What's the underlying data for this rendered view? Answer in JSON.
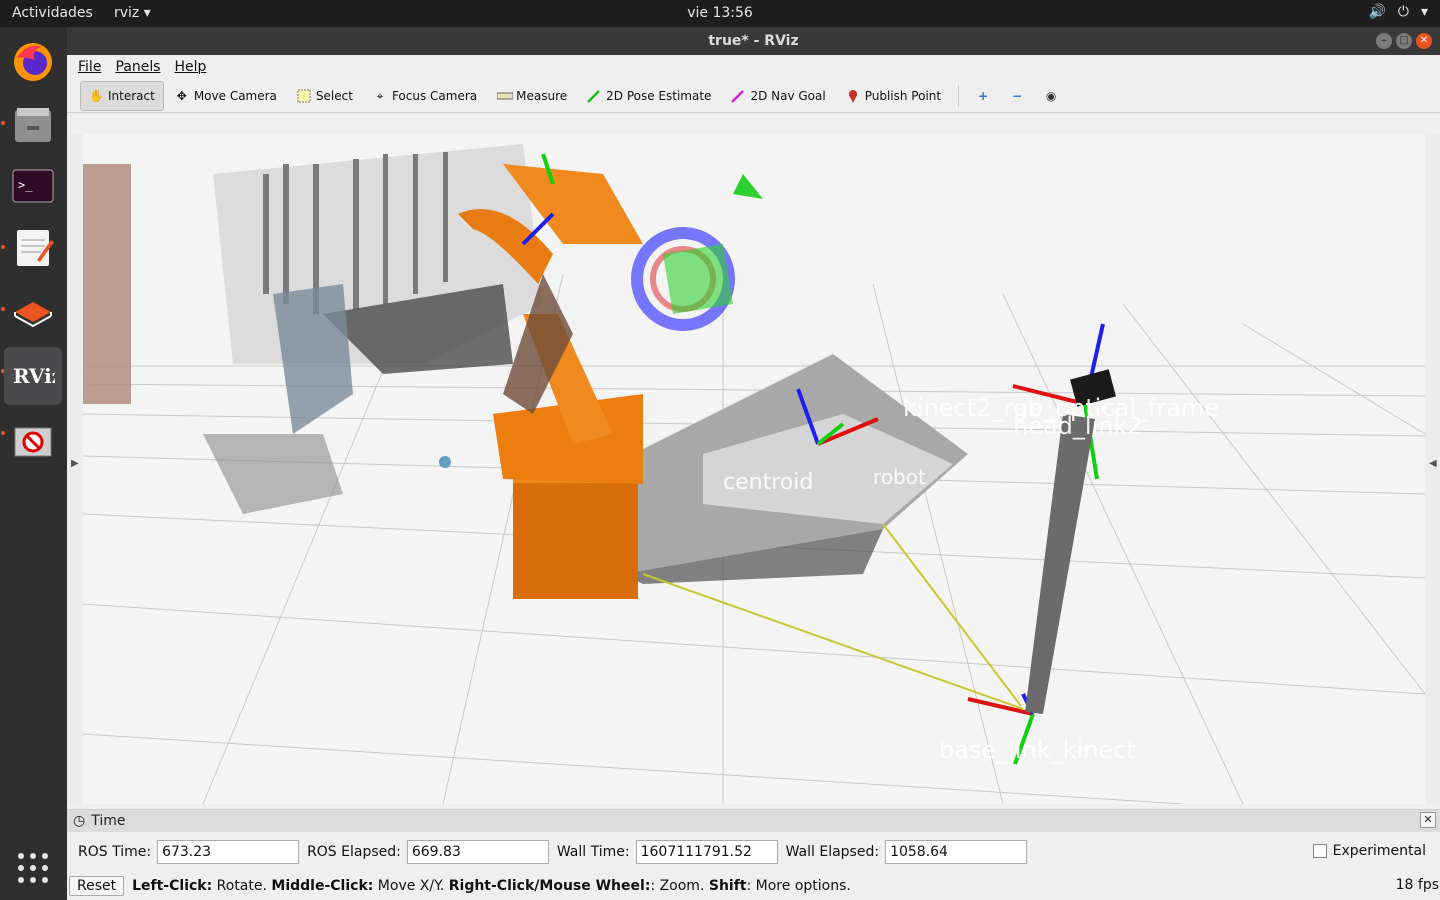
{
  "topbar": {
    "activities": "Actividades",
    "app": "rviz ▾",
    "clock": "vie 13:56"
  },
  "window": {
    "title": "true* - RViz"
  },
  "menu": [
    "File",
    "Panels",
    "Help"
  ],
  "tools": [
    {
      "label": "Interact",
      "icon": "hand-icon"
    },
    {
      "label": "Move Camera",
      "icon": "move-icon"
    },
    {
      "label": "Select",
      "icon": "select-icon"
    },
    {
      "label": "Focus Camera",
      "icon": "focus-icon"
    },
    {
      "label": "Measure",
      "icon": "ruler-icon"
    },
    {
      "label": "2D Pose Estimate",
      "icon": "green-arrow-icon"
    },
    {
      "label": "2D Nav Goal",
      "icon": "magenta-arrow-icon"
    },
    {
      "label": "Publish Point",
      "icon": "pin-icon"
    }
  ],
  "scene_labels": {
    "kinect": "kinect2_rgb_optical_frame",
    "head": "head_link2",
    "centroid": "centroid",
    "robot": "robot",
    "base": "base_link_kinect"
  },
  "time": {
    "panel_title": "Time",
    "ros_time_label": "ROS Time:",
    "ros_time": "673.23",
    "ros_elapsed_label": "ROS Elapsed:",
    "ros_elapsed": "669.83",
    "wall_time_label": "Wall Time:",
    "wall_time": "1607111791.52",
    "wall_elapsed_label": "Wall Elapsed:",
    "wall_elapsed": "1058.64",
    "experimental": "Experimental"
  },
  "status": {
    "reset": "Reset",
    "left_bold": "Left-Click:",
    "left_text": " Rotate. ",
    "middle_bold": "Middle-Click:",
    "middle_text": " Move X/Y. ",
    "right_bold": "Right-Click/Mouse Wheel:",
    "right_text": ": Zoom. ",
    "shift_bold": "Shift",
    "shift_text": ": More options.",
    "fps": "18 fps"
  }
}
